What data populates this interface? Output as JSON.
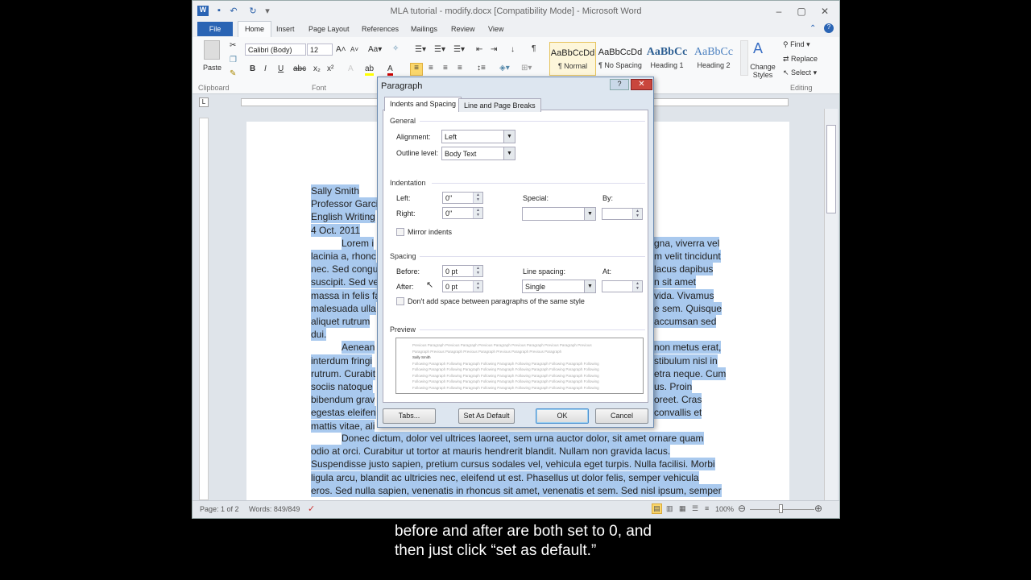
{
  "window": {
    "title": "MLA tutorial - modify.docx [Compatibility Mode] - Microsoft Word"
  },
  "ribbon": {
    "tabs": [
      "File",
      "Home",
      "Insert",
      "Page Layout",
      "References",
      "Mailings",
      "Review",
      "View"
    ],
    "active_tab": "Home",
    "clipboard": {
      "paste": "Paste",
      "group": "Clipboard"
    },
    "font": {
      "name": "Calibri (Body)",
      "size": "12",
      "group": "Font",
      "bold": "B",
      "italic": "I",
      "underline": "U"
    },
    "styles": [
      {
        "preview": "AaBbCcDd",
        "name": "¶ Normal"
      },
      {
        "preview": "AaBbCcDd",
        "name": "¶ No Spacing"
      },
      {
        "preview": "AaBbCc",
        "name": "Heading 1"
      },
      {
        "preview": "AaBbCc",
        "name": "Heading 2"
      }
    ],
    "change_styles": "Change Styles",
    "editing": {
      "find": "Find",
      "replace": "Replace",
      "select": "Select",
      "group": "Editing"
    },
    "accent": "#2a64b4"
  },
  "document": {
    "left_lines": [
      "Sally Smith",
      "Professor Garci",
      "English Writing",
      "4 Oct. 2011",
      "Lorem i",
      "lacinia a, rhonc",
      "nec. Sed congu",
      "suscipit. Sed ve",
      "massa in felis fa",
      "malesuada ulla",
      "aliquet rutrum",
      "dui.",
      "Aenean",
      "interdum fringi",
      "rutrum. Curabit",
      "sociis natoque",
      "bibendum grav",
      "egestas eleifen",
      "mattis vitae, ali"
    ],
    "right_lines": [
      "",
      "",
      "",
      "",
      "gna, viverra vel",
      "m velit tincidunt",
      "lacus dapibus",
      "n sit amet",
      "vida. Vivamus",
      "e sem. Quisque",
      "accumsan sed",
      "",
      "non metus erat,",
      "stibulum nisl in",
      "etra neque. Cum",
      "us. Proin",
      "oreet. Cras",
      "convallis et",
      ""
    ],
    "full_lines": [
      "Donec dictum, dolor vel ultrices laoreet, sem urna auctor dolor, sit amet ornare quam",
      "odio at orci. Curabitur ut tortor at mauris hendrerit blandit. Nullam non gravida lacus.",
      "Suspendisse justo sapien, pretium cursus sodales vel, vehicula eget turpis. Nulla facilisi. Morbi",
      "ligula arcu, blandit ac ultricies nec, eleifend ut est. Phasellus ut dolor felis, semper vehicula",
      "eros. Sed nulla sapien, venenatis in rhoncus sit amet, venenatis et sem. Sed nisl ipsum, semper"
    ],
    "selection_color": "#a9c9ee"
  },
  "status": {
    "page": "Page: 1 of 2",
    "words": "Words: 849/849",
    "zoom": "100%",
    "zoom_percent": 100
  },
  "dialog": {
    "title": "Paragraph",
    "tabs": [
      "Indents and Spacing",
      "Line and Page Breaks"
    ],
    "general": {
      "label": "General",
      "alignment_label": "Alignment:",
      "alignment": "Left",
      "outline_label": "Outline level:",
      "outline": "Body Text"
    },
    "indentation": {
      "label": "Indentation",
      "left_label": "Left:",
      "left": "0\"",
      "right_label": "Right:",
      "right": "0\"",
      "special_label": "Special:",
      "special": "",
      "by_label": "By:",
      "by": "",
      "mirror": "Mirror indents",
      "mirror_checked": false
    },
    "spacing": {
      "label": "Spacing",
      "before_label": "Before:",
      "before": "0 pt",
      "after_label": "After:",
      "after": "0 pt",
      "line_label": "Line spacing:",
      "line": "Single",
      "at_label": "At:",
      "at": "",
      "dont_add": "Don't add space between paragraphs of the same style",
      "dont_add_checked": false
    },
    "preview": {
      "label": "Preview",
      "prev": "Previous Paragraph Previous Paragraph Previous Paragraph Previous Paragraph Previous Paragraph Previous",
      "prev2": "Paragraph Previous Paragraph Previous Paragraph Previous Paragraph Previous Paragraph",
      "sample": "Sally Smith",
      "follow": "Following Paragraph Following Paragraph Following Paragraph Following Paragraph Following Paragraph Following"
    },
    "buttons": {
      "tabs": "Tabs...",
      "default": "Set As Default",
      "ok": "OK",
      "cancel": "Cancel"
    }
  },
  "caption": "before and after are both set to 0, and then just click “set as default.”"
}
